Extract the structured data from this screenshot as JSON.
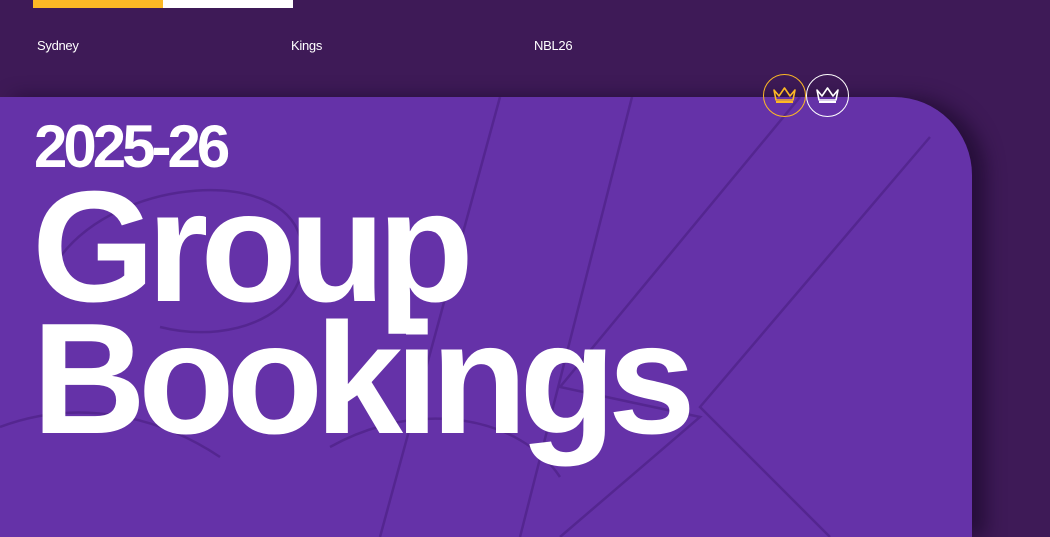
{
  "header": {
    "stripe_colors": [
      "#fdb825",
      "#ffffff"
    ],
    "meta": [
      "Sydney",
      "Kings",
      "NBL26"
    ]
  },
  "badges": [
    {
      "icon": "crown-icon",
      "color": "#fdb825"
    },
    {
      "icon": "crown-icon",
      "color": "#ffffff"
    }
  ],
  "hero": {
    "season": "2025-26",
    "headline_line1": "Group",
    "headline_line2": "Bookings",
    "background_color": "#6532a8",
    "page_background": "#3e1a57"
  }
}
